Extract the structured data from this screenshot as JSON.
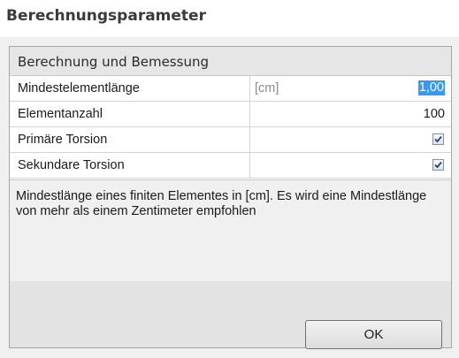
{
  "window": {
    "title": "Berechnungsparameter"
  },
  "group": {
    "label": "Berechnung und Bemessung"
  },
  "properties": [
    {
      "name": "Mindestelementlänge",
      "unit": "[cm]",
      "value": "1,00",
      "selected": true
    },
    {
      "name": "Elementanzahl",
      "unit": "",
      "value": "100"
    },
    {
      "name": "Primäre Torsion",
      "unit": "",
      "checked": true
    },
    {
      "name": "Sekundare Torsion",
      "unit": "",
      "checked": true
    }
  ],
  "description": {
    "text": "Mindestlänge eines finiten Elementes in [cm]. Es wird eine Mindestlänge von mehr als einem Zentimeter empfohlen"
  },
  "buttons": {
    "ok_label": "OK"
  },
  "colors": {
    "selection": "#3399ff",
    "header_bg": "#e6e6e6",
    "button_bar_bg": "#e3e3e3"
  }
}
